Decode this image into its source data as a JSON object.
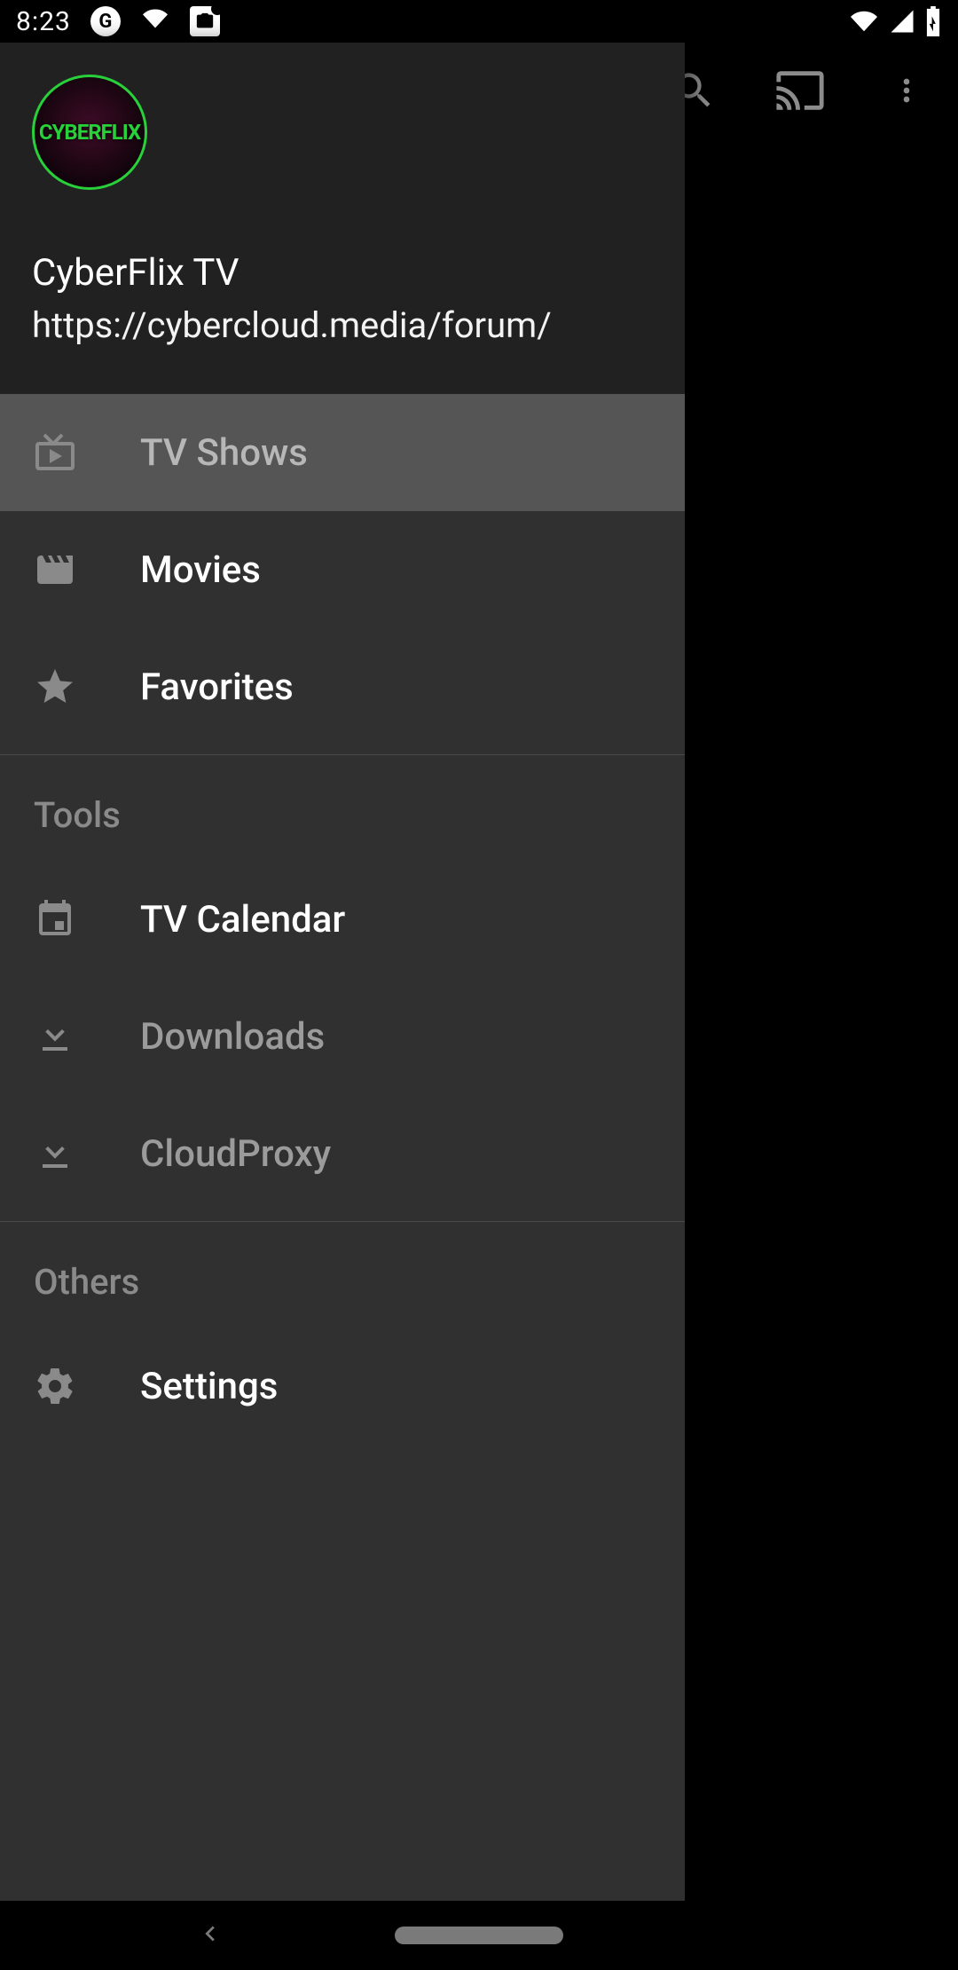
{
  "status_bar": {
    "clock": "8:23"
  },
  "appbar": {
    "icons": {
      "search": "search-icon",
      "cast": "cast-icon",
      "more": "more-vert-icon"
    }
  },
  "drawer": {
    "app_name": "CyberFlix TV",
    "app_url": "https://cybercloud.media/forum/",
    "avatar_text": "CYBERFLIX",
    "items": [
      {
        "icon": "live-tv-icon",
        "label": "TV Shows",
        "selected": true,
        "dim": true
      },
      {
        "icon": "movie-icon",
        "label": "Movies",
        "selected": false,
        "dim": false
      },
      {
        "icon": "star-icon",
        "label": "Favorites",
        "selected": false,
        "dim": false
      }
    ],
    "sections": [
      {
        "header": "Tools",
        "items": [
          {
            "icon": "calendar-icon",
            "label": "TV Calendar",
            "selected": false,
            "dim": false
          },
          {
            "icon": "download-icon",
            "label": "Downloads",
            "selected": false,
            "dim": true
          },
          {
            "icon": "download-icon",
            "label": "CloudProxy",
            "selected": false,
            "dim": true
          }
        ]
      },
      {
        "header": "Others",
        "items": [
          {
            "icon": "gear-icon",
            "label": "Settings",
            "selected": false,
            "dim": false
          }
        ]
      }
    ]
  }
}
